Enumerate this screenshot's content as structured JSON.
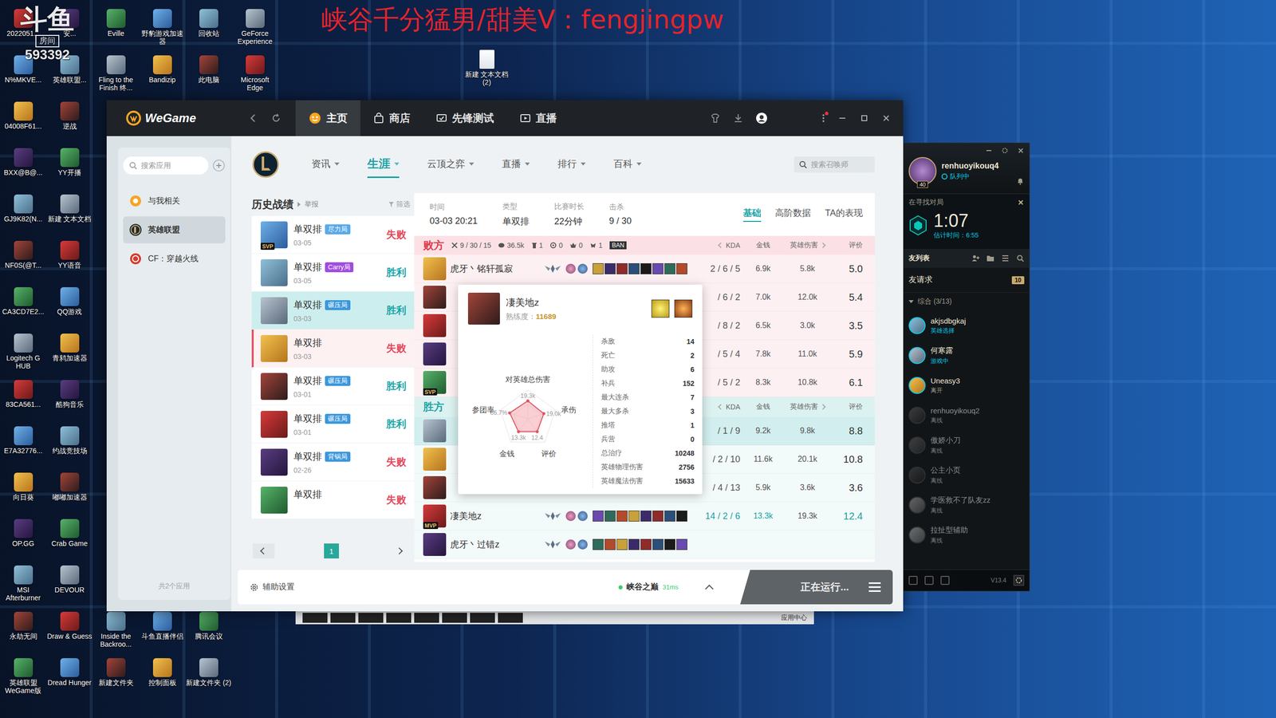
{
  "banner": "峡谷千分猛男/甜美V：fengjingpw",
  "watermark": {
    "logo": "斗鱼",
    "room_label": "房间",
    "room_id": "593392"
  },
  "desktop": {
    "columns": [
      {
        "top": [
          "2022051...",
          "N%MKVE...",
          "04008F61...",
          "BXX@B@...",
          "GJ9K82(N...",
          "NF0S(@T...",
          "CA3CD7E2...",
          "Logitech G HUB",
          "83CA561...",
          "E7A32776...",
          "向日葵",
          "OP.GG",
          "MSI Afterburner",
          "永劫无间",
          "英雄联盟 WeGame版"
        ],
        "bottom": []
      },
      {
        "top": [
          "安...",
          "英雄联盟...",
          "逆战",
          "YY开播",
          "新建 文本文档",
          "YY语音",
          "QQ游戏",
          "青鸫加速器",
          "酷狗音乐",
          "约战竞技场",
          "嘟嘟加速器",
          "Crab Game",
          "DEVOUR",
          "Draw & Guess",
          "Dread Hunger"
        ],
        "bottom": []
      },
      {
        "top": [
          "Eville",
          "Fling to the Finish 终..."
        ],
        "bottom": [
          "Inside the Backroo...",
          "新建文件夹"
        ]
      },
      {
        "top": [
          "野豹游戏加速器",
          "Bandizip"
        ],
        "bottom": [
          "斗鱼直播伴侣",
          "控制面板"
        ]
      },
      {
        "top": [
          "回收站",
          "此电脑"
        ],
        "bottom": [
          "腾讯会议",
          "新建文件夹 (2)"
        ]
      },
      {
        "top": [
          "GeForce Experience",
          "Microsoft Edge"
        ],
        "bottom": []
      }
    ],
    "loose_icon": "新建 文本文档 (2)"
  },
  "taskbar_strip": {
    "label": "应用中心"
  },
  "wegame": {
    "logo": "WeGame",
    "has_notice": true,
    "tabs": [
      {
        "label": "主页",
        "selected": true,
        "kind": "home"
      },
      {
        "label": "商店",
        "selected": false,
        "kind": "store"
      },
      {
        "label": "先锋测试",
        "selected": false,
        "kind": "test"
      },
      {
        "label": "直播",
        "selected": false,
        "kind": "live"
      }
    ],
    "sidebar": {
      "search_placeholder": "搜索应用",
      "items": [
        {
          "label": "与我相关",
          "selected": false,
          "kind": "related"
        },
        {
          "label": "英雄联盟",
          "selected": true,
          "kind": "lol"
        },
        {
          "label": "CF：穿越火线",
          "selected": false,
          "kind": "cf"
        }
      ],
      "footer": "共2个应用"
    },
    "nav": {
      "items": [
        {
          "label": "资讯",
          "selected": false
        },
        {
          "label": "生涯",
          "selected": true
        },
        {
          "label": "云顶之弈",
          "selected": false
        },
        {
          "label": "直播",
          "selected": false
        },
        {
          "label": "排行",
          "selected": false
        },
        {
          "label": "百科",
          "selected": false
        }
      ],
      "search_placeholder": "搜索召唤师"
    },
    "history": {
      "title": "历史战绩",
      "report": "举报",
      "filter": "筛选",
      "page": "1",
      "matches": [
        {
          "mode": "单双排",
          "tag": "尽力局",
          "color": "#5aaae8",
          "date": "03-05",
          "result": "失败",
          "won": false,
          "badge": "SVP",
          "selected": false,
          "hovered": false
        },
        {
          "mode": "单双排",
          "tag": "Carry局",
          "color": "#a04de0",
          "date": "03-05",
          "result": "胜利",
          "won": true,
          "badge": "",
          "selected": false,
          "hovered": false
        },
        {
          "mode": "单双排",
          "tag": "碾压局",
          "color": "#3b97dc",
          "date": "03-03",
          "result": "胜利",
          "won": true,
          "badge": "",
          "selected": true,
          "hovered": false
        },
        {
          "mode": "单双排",
          "tag": "",
          "color": "",
          "date": "03-03",
          "result": "失败",
          "won": false,
          "badge": "",
          "selected": false,
          "hovered": true
        },
        {
          "mode": "单双排",
          "tag": "碾压局",
          "color": "#3b97dc",
          "date": "03-01",
          "result": "胜利",
          "won": true,
          "badge": "",
          "selected": false,
          "hovered": false
        },
        {
          "mode": "单双排",
          "tag": "碾压局",
          "color": "#3b97dc",
          "date": "03-01",
          "result": "胜利",
          "won": true,
          "badge": "",
          "selected": false,
          "hovered": false
        },
        {
          "mode": "单双排",
          "tag": "背锅局",
          "color": "#3b97dc",
          "date": "02-26",
          "result": "失败",
          "won": false,
          "badge": "",
          "selected": false,
          "hovered": false
        },
        {
          "mode": "单双排",
          "tag": "",
          "color": "",
          "date": "",
          "result": "失败",
          "won": false,
          "badge": "",
          "selected": false,
          "hovered": false
        }
      ]
    },
    "detail": {
      "info": [
        {
          "label": "时间",
          "value": "03-03 20:21"
        },
        {
          "label": "类型",
          "value": "单双排"
        },
        {
          "label": "比赛时长",
          "value": "22分钟"
        },
        {
          "label": "击杀",
          "value": "9 / 30"
        }
      ],
      "tabs": [
        {
          "label": "基础",
          "selected": true
        },
        {
          "label": "高阶数据",
          "selected": false
        },
        {
          "label": "TA的表现",
          "selected": false
        }
      ],
      "columns": {
        "kda": "KDA",
        "gold": "金钱",
        "damage": "英雄伤害",
        "rating": "评价"
      },
      "teams": [
        {
          "result": "败方",
          "won": false,
          "ban": "BAN",
          "summary": {
            "kills": "9 / 30 / 15",
            "gold": "36.5k",
            "towers": "1",
            "inhibitors": "0",
            "barons": "0",
            "dragons": "1"
          },
          "players": [
            {
              "name": "虎牙丶铭轩孤寂",
              "kda": "2 / 6 / 5",
              "gold": "6.9k",
              "damage": "5.8k",
              "rating": "5.0",
              "badge": "",
              "highlighted": false
            },
            {
              "name": "",
              "kda": "/ 6 / 2",
              "gold": "7.0k",
              "damage": "12.0k",
              "rating": "5.4",
              "badge": "",
              "highlighted": false
            },
            {
              "name": "",
              "kda": "/ 8 / 2",
              "gold": "6.5k",
              "damage": "3.0k",
              "rating": "3.5",
              "badge": "",
              "highlighted": false
            },
            {
              "name": "",
              "kda": "/ 5 / 4",
              "gold": "7.8k",
              "damage": "11.0k",
              "rating": "5.9",
              "badge": "",
              "highlighted": false
            },
            {
              "name": "",
              "kda": "/ 5 / 2",
              "gold": "8.3k",
              "damage": "10.8k",
              "rating": "6.1",
              "badge": "SVP",
              "highlighted": false
            }
          ]
        },
        {
          "result": "胜方",
          "won": true,
          "ban": "",
          "summary": null,
          "players": [
            {
              "name": "",
              "kda": "/ 1 / 9",
              "gold": "9.2k",
              "damage": "9.8k",
              "rating": "8.8",
              "badge": "",
              "highlighted": true
            },
            {
              "name": "",
              "kda": "/ 2 / 10",
              "gold": "11.6k",
              "damage": "20.1k",
              "rating": "10.8",
              "badge": "",
              "highlighted": false
            },
            {
              "name": "",
              "kda": "/ 4 / 13",
              "gold": "5.9k",
              "damage": "3.6k",
              "rating": "3.6",
              "badge": "",
              "highlighted": false
            },
            {
              "name": "凄美地z",
              "kda": "14 / 2 / 6",
              "gold": "13.3k",
              "damage": "19.3k",
              "rating": "12.4",
              "badge": "MVP",
              "highlighted": false
            },
            {
              "name": "虎牙丶过错z",
              "kda": "",
              "gold": "",
              "damage": "",
              "rating": "",
              "badge": "",
              "highlighted": false
            }
          ]
        }
      ],
      "tooltip": {
        "name": "凄美地z",
        "mastery_label": "熟练度：",
        "mastery": "11689",
        "chart": {
          "axes": [
            {
              "label": "对英雄总伤害",
              "value": "19.3k",
              "level": 0.62
            },
            {
              "label": "承伤",
              "value": "19.0k",
              "level": 0.58
            },
            {
              "label": "评价",
              "value": "12.4",
              "level": 0.55
            },
            {
              "label": "金钱",
              "value": "13.3k",
              "level": 0.55
            },
            {
              "label": "参团率",
              "value": "66.7%",
              "level": 0.66
            }
          ]
        },
        "stats": [
          {
            "label": "杀敌",
            "value": "14"
          },
          {
            "label": "死亡",
            "value": "2"
          },
          {
            "label": "助攻",
            "value": "6"
          },
          {
            "label": "补兵",
            "value": "152"
          },
          {
            "label": "最大连杀",
            "value": "7"
          },
          {
            "label": "最大多杀",
            "value": "3"
          },
          {
            "label": "推塔",
            "value": "1"
          },
          {
            "label": "兵营",
            "value": "0"
          },
          {
            "label": "总治疗",
            "value": "10248"
          },
          {
            "label": "英雄物理伤害",
            "value": "2756"
          },
          {
            "label": "英雄魔法伤害",
            "value": "15633"
          }
        ]
      }
    },
    "bottom_bar": {
      "assist": "辅助设置",
      "server": "峡谷之巅",
      "ping": "31ms",
      "running": "正在运行..."
    }
  },
  "client": {
    "name": "renhuoyikouq4",
    "level": "40",
    "status": "队列中",
    "queue": {
      "title": "在寻找对局",
      "time": "1:07",
      "estimate": "估计时间：6:55"
    },
    "friends_title": "友列表",
    "requests": {
      "label": "友请求",
      "count": "10"
    },
    "group": "综合 (3/13)",
    "friends": [
      {
        "name": "akjsdbgkaj",
        "status": "英雄选择",
        "online": true,
        "color": "#0acbe6"
      },
      {
        "name": "何寒露",
        "status": "游戏中",
        "online": true,
        "color": "#0acbe6"
      },
      {
        "name": "Uneasy3",
        "status": "离开",
        "online": true,
        "color": "#a09b8c"
      },
      {
        "name": "renhuoyikouq2",
        "status": "离线",
        "online": false,
        "color": "#7c7c7c"
      },
      {
        "name": "傲娇小刀",
        "status": "离线",
        "online": false,
        "color": "#7c7c7c"
      },
      {
        "name": "公主小页",
        "status": "离线",
        "online": false,
        "color": "#7c7c7c"
      },
      {
        "name": "学医救不了队友zz",
        "status": "离线",
        "online": false,
        "color": "#7c7c7c"
      },
      {
        "name": "拉扯型辅助",
        "status": "离线",
        "online": false,
        "color": "#7c7c7c"
      }
    ],
    "version": "V13.4"
  }
}
